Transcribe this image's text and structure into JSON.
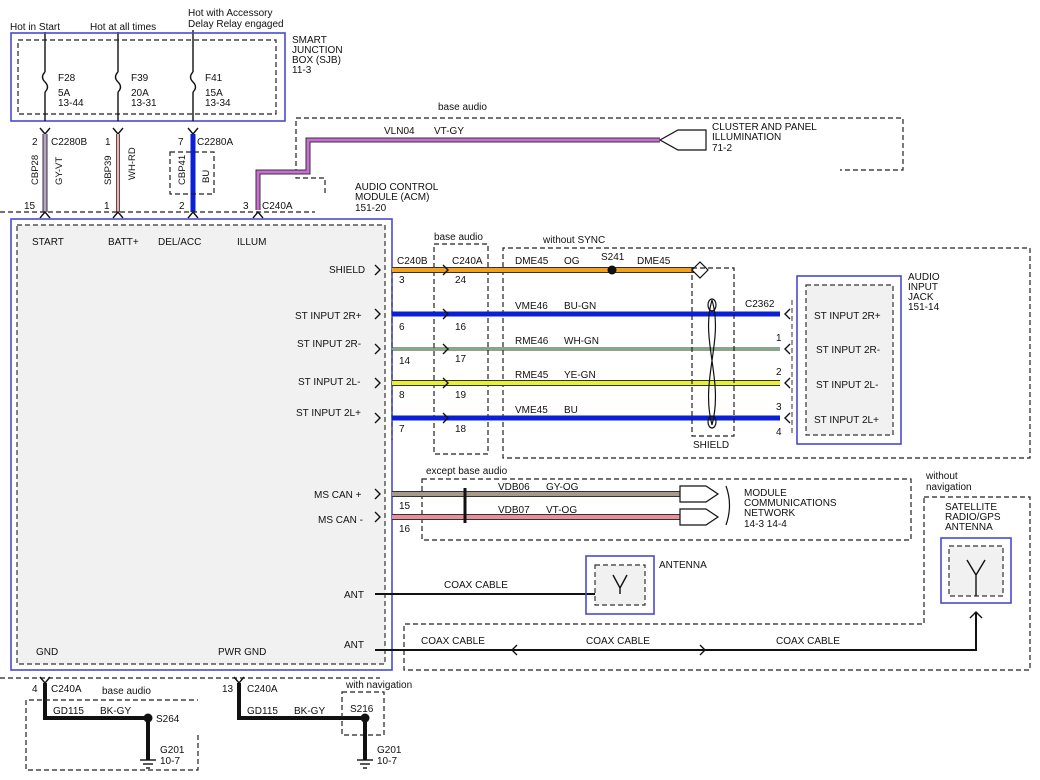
{
  "power": {
    "hot_in_start": "Hot in Start",
    "hot_at_all_times": "Hot at all times",
    "hot_accessory_line1": "Hot with Accessory",
    "hot_accessory_line2": "Delay Relay engaged"
  },
  "sjb": {
    "line1": "SMART",
    "line2": "JUNCTION",
    "line3": "BOX (SJB)",
    "ref": "11-3",
    "fuses": [
      {
        "name": "F28",
        "amps": "5A",
        "ref": "13-44"
      },
      {
        "name": "F39",
        "amps": "20A",
        "ref": "13-31"
      },
      {
        "name": "F41",
        "amps": "15A",
        "ref": "13-34"
      }
    ]
  },
  "connectors": {
    "c2280b": "C2280B",
    "c2280a": "C2280A",
    "c240a": "C240A",
    "c240b": "C240B",
    "c2362": "C2362",
    "pin_2": "2",
    "pin_1": "1",
    "pin_7": "7",
    "pin_15": "15",
    "pin_1b": "1",
    "pin_2b": "2",
    "pin_3": "3"
  },
  "top_wires": [
    {
      "circuit": "CBP28",
      "color": "GY-VT"
    },
    {
      "circuit": "SBP39",
      "color": "WH-RD"
    },
    {
      "circuit": "CBP41",
      "color": "BU"
    }
  ],
  "illum": {
    "base_audio": "base audio",
    "circuit": "VLN04",
    "color": "VT-GY",
    "dest_line1": "CLUSTER AND PANEL",
    "dest_line2": "ILLUMINATION",
    "dest_ref": "71-2"
  },
  "acm": {
    "line1": "AUDIO CONTROL",
    "line2": "MODULE (ACM)",
    "ref": "151-20",
    "pins_top": [
      "START",
      "BATT+",
      "DEL/ACC",
      "ILLUM"
    ],
    "shield": "SHIELD",
    "st2rp": "ST INPUT 2R+",
    "st2rm": "ST INPUT 2R-",
    "st2lm": "ST INPUT 2L-",
    "st2lp": "ST INPUT 2L+",
    "mscanp": "MS CAN +",
    "mscanm": "MS CAN -",
    "ant1": "ANT",
    "ant2": "ANT",
    "gnd": "GND",
    "pwr_gnd": "PWR GND"
  },
  "audio": {
    "base_audio": "base audio",
    "without_sync": "without SYNC",
    "splice": "S241",
    "shield_label": "SHIELD",
    "b_pins": [
      "3",
      "6",
      "14",
      "8",
      "7"
    ],
    "a_pins": [
      "24",
      "16",
      "17",
      "19",
      "18"
    ],
    "wires": [
      {
        "circuit": "DME45",
        "color": "OG",
        "circuit2": "DME45"
      },
      {
        "circuit": "VME46",
        "color": "BU-GN"
      },
      {
        "circuit": "RME46",
        "color": "WH-GN"
      },
      {
        "circuit": "RME45",
        "color": "YE-GN"
      },
      {
        "circuit": "VME45",
        "color": "BU"
      }
    ],
    "jack_pins": [
      "1",
      "2",
      "3",
      "4"
    ],
    "jack_line1": "AUDIO",
    "jack_line2": "INPUT",
    "jack_line3": "JACK",
    "jack_ref": "151-14",
    "jack_labels": [
      "ST INPUT 2R+",
      "ST INPUT 2R-",
      "ST INPUT 2L-",
      "ST INPUT 2L+"
    ]
  },
  "can": {
    "except_base_audio": "except base audio",
    "wires": [
      {
        "circuit": "VDB06",
        "color": "GY-OG",
        "pin": "15"
      },
      {
        "circuit": "VDB07",
        "color": "VT-OG",
        "pin": "16"
      }
    ],
    "net_line1": "MODULE",
    "net_line2": "COMMUNICATIONS",
    "net_line3": "NETWORK",
    "net_ref": "14-3  14-4"
  },
  "antenna": {
    "coax": "COAX CABLE",
    "antenna_label": "ANTENNA",
    "without_nav1": "without",
    "without_nav2": "navigation",
    "sat_line1": "SATELLITE",
    "sat_line2": "RADIO/GPS",
    "sat_line3": "ANTENNA",
    "coax2": "COAX CABLE",
    "coax3": "COAX CABLE",
    "coax4": "COAX CABLE"
  },
  "ground": {
    "pin4": "4",
    "pin13": "13",
    "c240a_1": "C240A",
    "c240a_2": "C240A",
    "base_audio": "base audio",
    "with_navigation": "with navigation",
    "circuit1": "GD115",
    "color1": "BK-GY",
    "circuit2": "GD115",
    "color2": "BK-GY",
    "splice1": "S264",
    "splice2": "S216",
    "g1": "G201",
    "g1ref": "10-7",
    "g2": "G201",
    "g2ref": "10-7"
  },
  "colors": {
    "gray_violet": "#b9a3c9",
    "white_red": "#f0b0b0",
    "blue": "#0a1fd6",
    "violet_gray": "#cc6cd6",
    "orange": "#f2a020",
    "white_green": "#9ad49a",
    "yellow_green": "#e8f030",
    "gray_orange": "#a89a88",
    "violet_orange": "#e8909a",
    "frame": "#4a4ad0"
  }
}
